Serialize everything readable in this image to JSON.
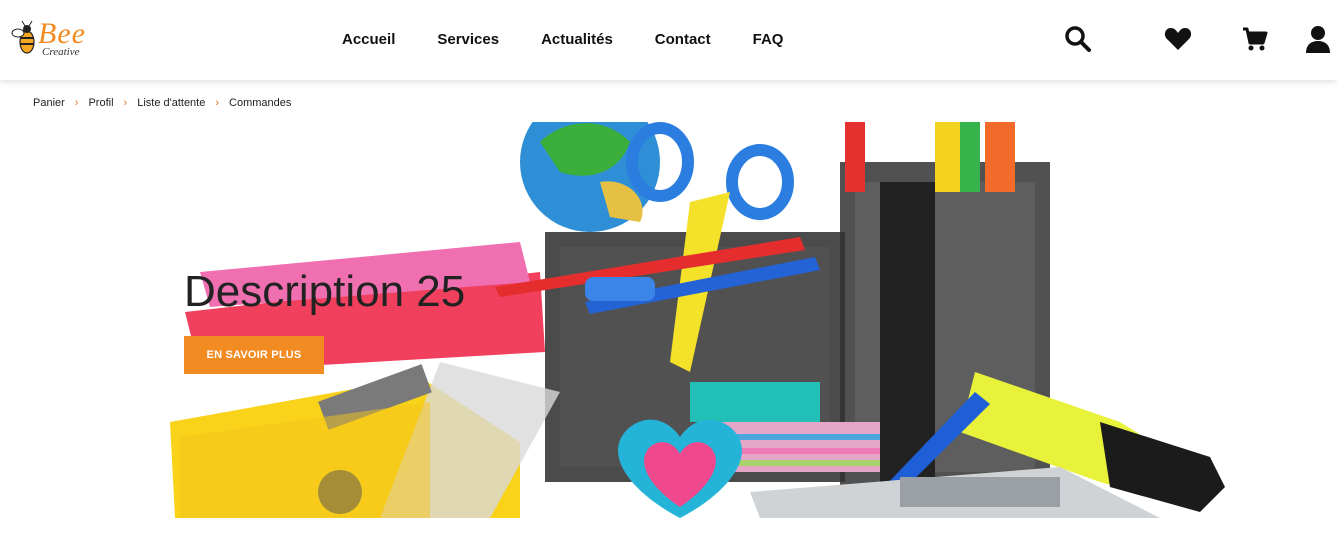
{
  "brand": {
    "name": "Bee",
    "subtitle": "Creative",
    "color": "#f08a1c"
  },
  "nav": {
    "items": [
      {
        "label": "Accueil"
      },
      {
        "label": "Services"
      },
      {
        "label": "Actualités"
      },
      {
        "label": "Contact"
      },
      {
        "label": "FAQ"
      }
    ]
  },
  "header_icons": [
    "search-icon",
    "heart-icon",
    "cart-icon",
    "user-icon"
  ],
  "breadcrumb": {
    "items": [
      {
        "label": "Panier"
      },
      {
        "label": "Profil"
      },
      {
        "label": "Liste d'attente"
      },
      {
        "label": "Commandes"
      }
    ],
    "separator": "›",
    "separator_color": "#e0732a"
  },
  "hero": {
    "title": "Description 25",
    "button_label": "EN SAVOIR PLUS",
    "button_color": "#f28b22"
  }
}
